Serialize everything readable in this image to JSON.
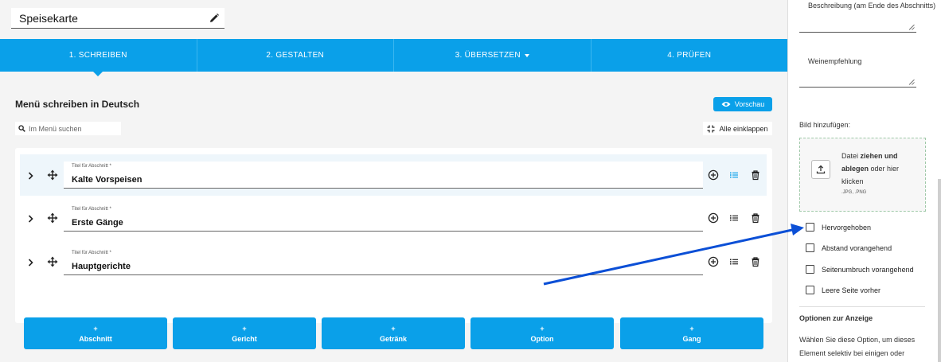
{
  "document": {
    "title": "Speisekarte"
  },
  "stepper": {
    "steps": [
      {
        "label": "1. SCHREIBEN"
      },
      {
        "label": "2. GESTALTEN"
      },
      {
        "label": "3. ÜBERSETZEN"
      },
      {
        "label": "4. PRÜFEN"
      }
    ],
    "active_step": 0
  },
  "editor": {
    "heading": "Menü schreiben in Deutsch",
    "preview_label": "Vorschau",
    "search_placeholder": "Im Menü suchen",
    "collapse_label": "Alle einklappen"
  },
  "sections": [
    {
      "field_label": "Titel für Abschnitt *",
      "value": "Kalte Vorspeisen",
      "highlighted": true
    },
    {
      "field_label": "Titel für Abschnitt *",
      "value": "Erste Gänge",
      "highlighted": false
    },
    {
      "field_label": "Titel für Abschnitt *",
      "value": "Hauptgerichte",
      "highlighted": false
    }
  ],
  "add_buttons": [
    {
      "plus": "+",
      "label": "Abschnitt"
    },
    {
      "plus": "+",
      "label": "Gericht"
    },
    {
      "plus": "+",
      "label": "Getränk"
    },
    {
      "plus": "+",
      "label": "Option"
    },
    {
      "plus": "+",
      "label": "Gang"
    }
  ],
  "sidebar": {
    "description_label": "Beschreibung (am Ende des Abschnitts)",
    "wine_label": "Weinempfehlung",
    "image_label": "Bild hinzufügen:",
    "drop_text_1": "Datei ",
    "drop_text_bold": "ziehen und ablegen",
    "drop_text_2": " oder hier klicken",
    "drop_formats": ".JPG, .PNG",
    "checkboxes": [
      {
        "label": "Hervorgehoben",
        "checked": false
      },
      {
        "label": "Abstand vorangehend",
        "checked": false
      },
      {
        "label": "Seitenumbruch vorangehend",
        "checked": false
      },
      {
        "label": "Leere Seite vorher",
        "checked": false
      }
    ],
    "display_options_heading": "Optionen zur Anzeige",
    "display_options_text": "Wählen Sie diese Option, um dieses Element selektiv bei einigen oder allen außer einigen Menüs"
  },
  "colors": {
    "accent": "#0aa0e9",
    "annotation_arrow": "#0b4fd6"
  }
}
